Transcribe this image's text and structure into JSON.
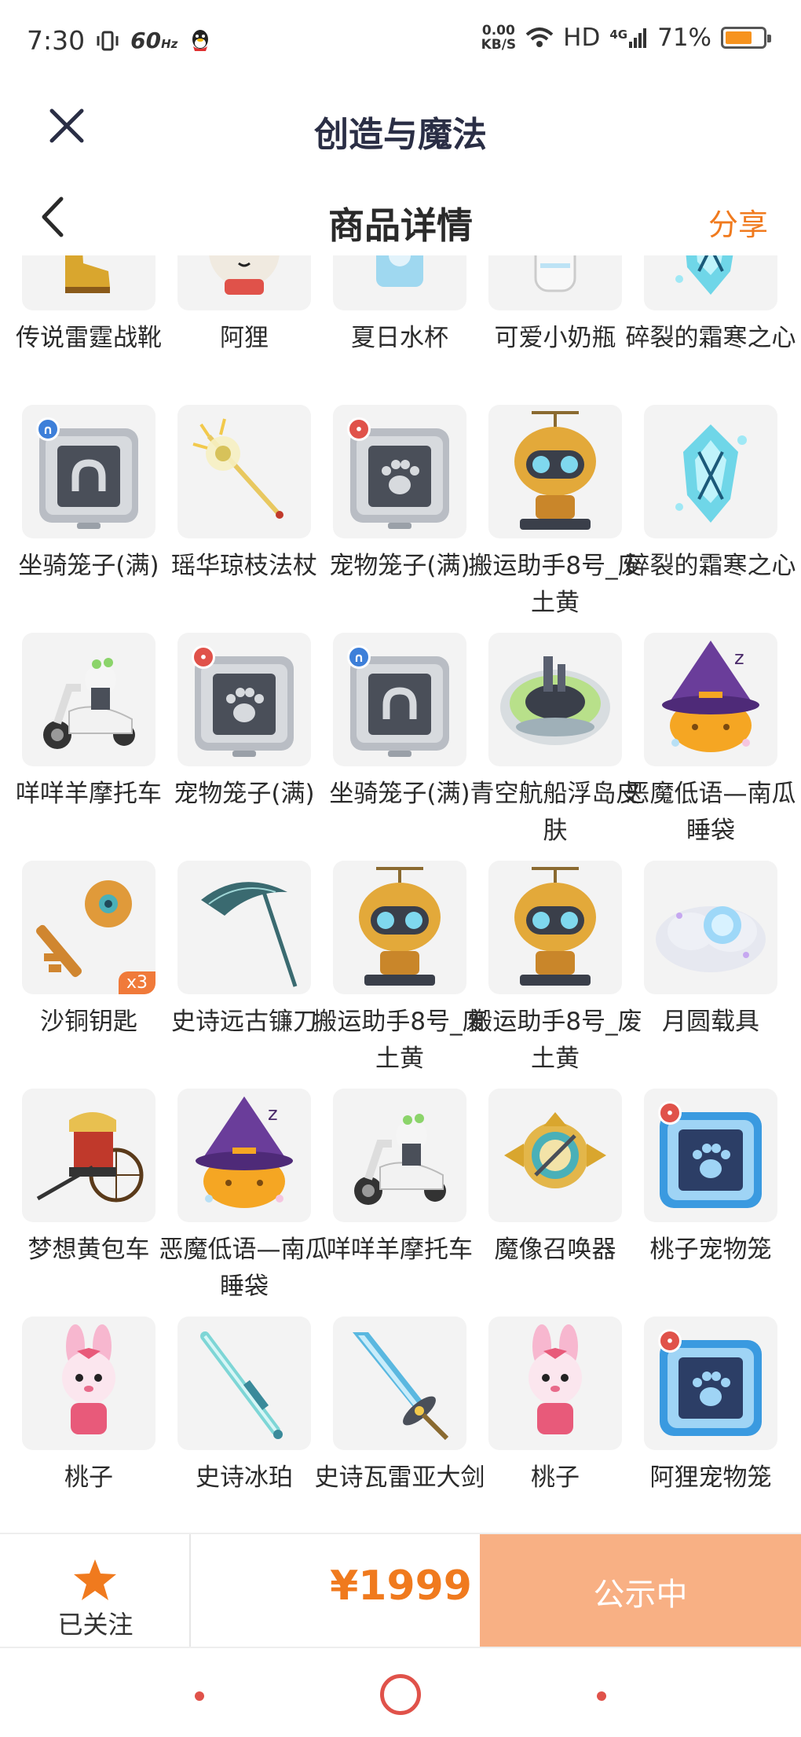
{
  "status_bar": {
    "time": "7:30",
    "refresh": "60",
    "refresh_unit": "Hz",
    "net_speed_value": "0.00",
    "net_speed_unit": "KB/S",
    "hd": "HD",
    "network": "4G",
    "battery": "71%",
    "battery_level": 0.71
  },
  "app_bar": {
    "title": "创造与魔法",
    "close_icon": "close-icon"
  },
  "nav_bar": {
    "title": "商品详情",
    "share": "分享",
    "back_icon": "chevron-left-icon"
  },
  "items": [
    {
      "name": "传说雷霆战靴",
      "icon": "boots-icon"
    },
    {
      "name": "阿狸",
      "icon": "fox-icon"
    },
    {
      "name": "夏日水杯",
      "icon": "cup-icon"
    },
    {
      "name": "可爱小奶瓶",
      "icon": "bottle-icon"
    },
    {
      "name": "碎裂的霜寒之心",
      "icon": "frost-heart-icon"
    },
    {
      "name": "坐骑笼子(满)",
      "icon": "mount-cage-icon",
      "badge": "blue"
    },
    {
      "name": "瑶华琼枝法杖",
      "icon": "staff-icon"
    },
    {
      "name": "宠物笼子(满)",
      "icon": "pet-cage-icon",
      "badge": "red"
    },
    {
      "name": "搬运助手8号_废土黄",
      "icon": "robot-icon"
    },
    {
      "name": "碎裂的霜寒之心",
      "icon": "frost-heart-icon"
    },
    {
      "name": "咩咩羊摩托车",
      "icon": "scooter-icon"
    },
    {
      "name": "宠物笼子(满)",
      "icon": "pet-cage-icon",
      "badge": "red"
    },
    {
      "name": "坐骑笼子(满)",
      "icon": "mount-cage-icon",
      "badge": "blue"
    },
    {
      "name": "青空航船浮岛皮肤",
      "icon": "island-icon"
    },
    {
      "name": "恶魔低语—南瓜睡袋",
      "icon": "pumpkin-icon"
    },
    {
      "name": "沙铜钥匙",
      "icon": "key-icon",
      "qty": "x3"
    },
    {
      "name": "史诗远古镰刀",
      "icon": "scythe-icon"
    },
    {
      "name": "搬运助手8号_废土黄",
      "icon": "robot-icon"
    },
    {
      "name": "搬运助手8号_废土黄",
      "icon": "robot-icon"
    },
    {
      "name": "月圆载具",
      "icon": "moon-cloud-icon"
    },
    {
      "name": "梦想黄包车",
      "icon": "rickshaw-icon"
    },
    {
      "name": "恶魔低语—南瓜睡袋",
      "icon": "pumpkin-icon"
    },
    {
      "name": "咩咩羊摩托车",
      "icon": "scooter-icon"
    },
    {
      "name": "魔像召唤器",
      "icon": "summoner-icon"
    },
    {
      "name": "桃子宠物笼",
      "icon": "blue-pet-cage-icon",
      "badge": "red"
    },
    {
      "name": "桃子",
      "icon": "bunny-icon"
    },
    {
      "name": "史诗冰珀",
      "icon": "ice-sword-icon"
    },
    {
      "name": "史诗瓦雷亚大剑",
      "icon": "greatsword-icon"
    },
    {
      "name": "桃子",
      "icon": "bunny-icon"
    },
    {
      "name": "阿狸宠物笼",
      "icon": "blue-pet-cage-icon",
      "badge": "red"
    }
  ],
  "action_bar": {
    "follow_label": "已关注",
    "price": "¥1999",
    "status_button": "公示中"
  },
  "colors": {
    "accent": "#f07a1e",
    "button_bg": "#f8b084",
    "tile_bg": "#f3f3f3"
  }
}
